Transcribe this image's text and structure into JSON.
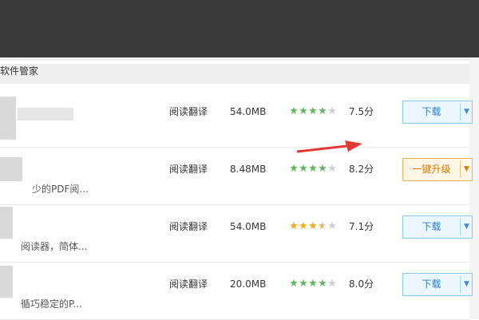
{
  "header": {
    "title": "软件管家"
  },
  "colors": {
    "star_green": "#5cb85c",
    "star_orange": "#f0ad1e",
    "star_empty": "#cfcfcf",
    "arrow_red": "#e53935"
  },
  "rows": [
    {
      "blur_text": "…",
      "desc": "",
      "category": "阅读翻译",
      "size": "54.0MB",
      "stars": 4,
      "star_color": "green",
      "score": "7.5分",
      "button": "下载",
      "button_type": "download"
    },
    {
      "blur_text": "",
      "desc": "少的PDF阅...",
      "category": "阅读翻译",
      "size": "8.48MB",
      "stars": 4,
      "star_color": "green",
      "score": "8.2分",
      "button": "一键升级",
      "button_type": "upgrade"
    },
    {
      "blur_text": "",
      "desc": "阅读器，简体...",
      "category": "阅读翻译",
      "size": "54.0MB",
      "stars": 3.5,
      "star_color": "orange",
      "score": "7.1分",
      "button": "下载",
      "button_type": "download"
    },
    {
      "blur_text": "",
      "desc": "循巧稳定的P...",
      "category": "阅读翻译",
      "size": "20.0MB",
      "stars": 4,
      "star_color": "green",
      "score": "8.0分",
      "button": "下载",
      "button_type": "download"
    }
  ]
}
